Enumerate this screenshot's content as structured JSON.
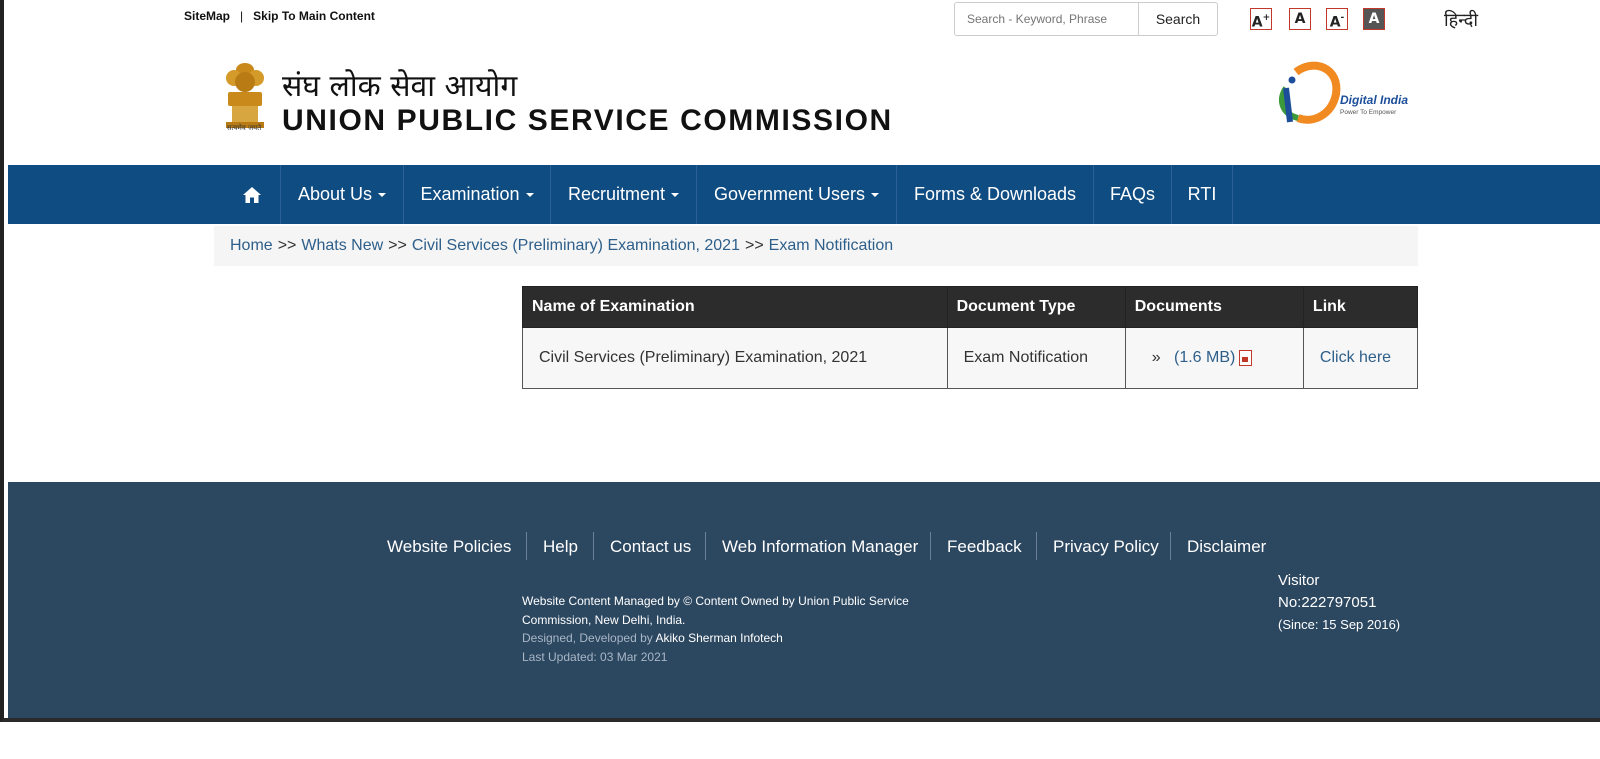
{
  "topbar": {
    "sitemap": "SiteMap",
    "separator": "|",
    "skip": "Skip To Main Content",
    "search_placeholder": "Search - Keyword, Phrase",
    "search_button": "Search",
    "font_larger": "A",
    "font_larger_sup": "+",
    "font_normal": "A",
    "font_smaller": "A",
    "font_smaller_sup": "-",
    "font_contrast": "A",
    "hindi": "हिन्दी"
  },
  "header": {
    "title_hindi": "संघ लोक सेवा आयोग",
    "title_english": "UNION PUBLIC SERVICE COMMISSION",
    "emblem_caption": "सत्यमेव जयते",
    "digital_india": "Digital India",
    "digital_india_tagline": "Power To Empower"
  },
  "nav": {
    "home_icon": "home-icon",
    "items": [
      "About Us",
      "Examination",
      "Recruitment",
      "Government Users",
      "Forms & Downloads",
      "FAQs",
      "RTI"
    ]
  },
  "breadcrumb": {
    "items": [
      "Home",
      "Whats New",
      "Civil Services (Preliminary) Examination, 2021",
      "Exam Notification"
    ],
    "separator": ">>"
  },
  "table": {
    "headers": [
      "Name of Examination",
      "Document Type",
      "Documents",
      "Link"
    ],
    "rows": [
      {
        "name": "Civil Services (Preliminary) Examination, 2021",
        "doc_type": "Exam Notification",
        "doc_bullet": "»",
        "doc_size": "(1.6 MB)",
        "link": "Click here"
      }
    ]
  },
  "footer": {
    "links": [
      "Website Policies",
      "Help",
      "Contact us",
      "Web Information Manager",
      "Feedback",
      "Privacy Policy",
      "Disclaimer"
    ],
    "credit_line1": "Website Content Managed by © Content Owned by Union Public Service Commission, New Delhi, India.",
    "designed_prefix": "Designed, Developed by",
    "designed_by": "Akiko Sherman Infotech",
    "last_updated": "Last Updated: 03 Mar 2021",
    "visitor_label": "Visitor",
    "visitor_count": "No:222797051",
    "visitor_since": "(Since: 15 Sep 2016)"
  },
  "colors": {
    "nav_bg": "#0f4c81",
    "footer_bg": "#2c4760",
    "link": "#2e5f8a",
    "table_header": "#2c2c2c"
  }
}
